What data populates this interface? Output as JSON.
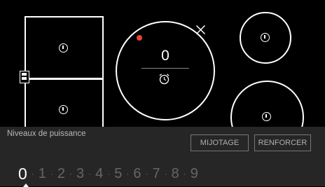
{
  "cooktop": {
    "zones": {
      "center": {
        "power_level": "0"
      }
    }
  },
  "power_panel": {
    "title": "Niveaux de puissance",
    "simmer_label": "MIJOTAGE",
    "boost_label": "RENFORCER",
    "levels": [
      "0",
      "1",
      "2",
      "3",
      "4",
      "5",
      "6",
      "7",
      "8",
      "9"
    ],
    "selected_level": "0",
    "separator": "·"
  },
  "colors": {
    "residual_heat": "#e8452c",
    "panel_background": "#262626",
    "cooktop_background": "#000000"
  },
  "icons": [
    "power-icon",
    "bridge-icon",
    "timer-icon",
    "close-icon",
    "residual-heat-dot"
  ]
}
